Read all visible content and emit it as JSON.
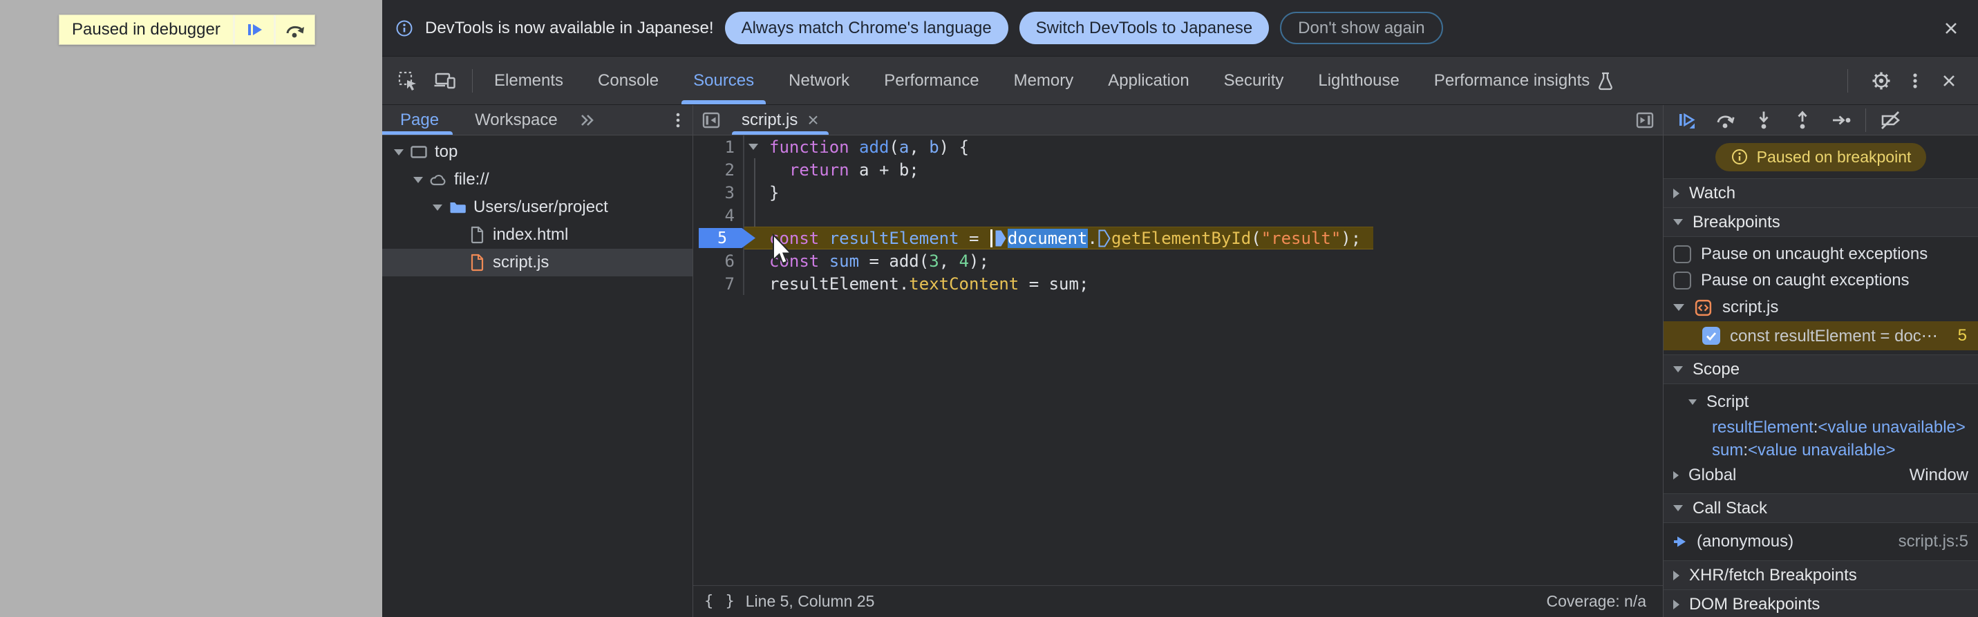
{
  "colors": {
    "accent": "#7cacf8",
    "paused_banner_bg": "#564717",
    "paused_banner_text": "#ecd56e",
    "execution_line_bg": "#57470f",
    "selection_bg": "#3c82d4",
    "infobar_button_bg": "#a8c7fa"
  },
  "page_area": {
    "paused_message": "Paused in debugger",
    "buttons": [
      {
        "name": "resume"
      },
      {
        "name": "step-over"
      }
    ]
  },
  "infobar": {
    "message": "DevTools is now available in Japanese!",
    "action_primary": "Always match Chrome's language",
    "action_secondary": "Switch DevTools to Japanese",
    "action_dismiss": "Don't show again"
  },
  "toolbar": {
    "tabs": [
      "Elements",
      "Console",
      "Sources",
      "Network",
      "Performance",
      "Memory",
      "Application",
      "Security",
      "Lighthouse",
      "Performance insights"
    ],
    "active_tab": "Sources",
    "experimental_tab": "Performance insights"
  },
  "navigator": {
    "tabs": [
      "Page",
      "Workspace"
    ],
    "active_tab": "Page",
    "tree": [
      {
        "label": "top",
        "icon": "frame-icon",
        "depth": 0,
        "expanded": true,
        "selected": false
      },
      {
        "label": "file://",
        "icon": "cloud-icon",
        "depth": 1,
        "expanded": true,
        "selected": false
      },
      {
        "label": "Users/user/project",
        "icon": "folder-icon",
        "depth": 2,
        "expanded": true,
        "selected": false
      },
      {
        "label": "index.html",
        "icon": "file-icon",
        "depth": 3,
        "expanded": null,
        "selected": false
      },
      {
        "label": "script.js",
        "icon": "file-js-icon",
        "depth": 3,
        "expanded": null,
        "selected": true
      }
    ]
  },
  "editor": {
    "tab": "script.js",
    "paused_line": 5,
    "lines": [
      {
        "n": 1,
        "fold": "open",
        "tokens": [
          [
            "kw",
            "function"
          ],
          [
            "d",
            " "
          ],
          [
            "fn",
            "add"
          ],
          [
            "d",
            "("
          ],
          [
            "var",
            "a"
          ],
          [
            "d",
            ", "
          ],
          [
            "var",
            "b"
          ],
          [
            "d",
            ") {"
          ]
        ]
      },
      {
        "n": 2,
        "fold": "guide",
        "tokens": [
          [
            "d",
            "  "
          ],
          [
            "kw",
            "return"
          ],
          [
            "d",
            " a + b;"
          ]
        ]
      },
      {
        "n": 3,
        "fold": "guide",
        "tokens": [
          [
            "d",
            "}"
          ]
        ]
      },
      {
        "n": 4,
        "fold": "guide",
        "tokens": []
      },
      {
        "n": 5,
        "fold": "none",
        "exec": true,
        "tokens": [
          [
            "kw",
            "const"
          ],
          [
            "d",
            " "
          ],
          [
            "var",
            "resultElement"
          ],
          [
            "d",
            " = "
          ],
          [
            "caret",
            ""
          ],
          [
            "marker-filled",
            ""
          ],
          [
            "sel",
            "document"
          ],
          [
            "d",
            "."
          ],
          [
            "marker-outline",
            ""
          ],
          [
            "prop",
            "getElementById"
          ],
          [
            "d",
            "("
          ],
          [
            "str",
            "\"result\""
          ],
          [
            "d",
            ");"
          ]
        ]
      },
      {
        "n": 6,
        "fold": "none",
        "tokens": [
          [
            "kw",
            "const"
          ],
          [
            "d",
            " "
          ],
          [
            "var",
            "sum"
          ],
          [
            "d",
            " = add("
          ],
          [
            "num",
            "3"
          ],
          [
            "d",
            ", "
          ],
          [
            "num",
            "4"
          ],
          [
            "d",
            ");"
          ]
        ]
      },
      {
        "n": 7,
        "fold": "none",
        "tokens": [
          [
            "d",
            "resultElement."
          ],
          [
            "prop",
            "textContent"
          ],
          [
            "d",
            " = sum;"
          ]
        ]
      }
    ],
    "status": {
      "position": "Line 5, Column 25",
      "coverage": "Coverage: n/a"
    }
  },
  "debugger": {
    "toolbar_icons": [
      "resume",
      "step-over",
      "step-into",
      "step-out",
      "step",
      "deactivate-breakpoints"
    ],
    "status_banner": "Paused on breakpoint",
    "watch": {
      "label": "Watch",
      "collapsed": true
    },
    "breakpoints": {
      "label": "Breakpoints",
      "collapsed": false,
      "pause_uncaught": {
        "label": "Pause on uncaught exceptions",
        "checked": false
      },
      "pause_caught": {
        "label": "Pause on caught exceptions",
        "checked": false
      },
      "file_group": "script.js",
      "entry": {
        "checked": true,
        "code": "const resultElement = doc⋯",
        "line": "5"
      }
    },
    "scope": {
      "label": "Scope",
      "groups": {
        "script": {
          "label": "Script",
          "vars": [
            {
              "name": "resultElement",
              "sep": ": ",
              "value": "<value unavailable>"
            },
            {
              "name": "sum",
              "sep": ": ",
              "value": "<value unavailable>"
            }
          ]
        },
        "global": {
          "label": "Global",
          "value": "Window"
        }
      }
    },
    "call_stack": {
      "label": "Call Stack",
      "frames": [
        {
          "label": "(anonymous)",
          "location": "script.js:5"
        }
      ]
    },
    "xhr": {
      "label": "XHR/fetch Breakpoints",
      "collapsed": true
    },
    "dom": {
      "label": "DOM Breakpoints",
      "collapsed": true
    }
  }
}
